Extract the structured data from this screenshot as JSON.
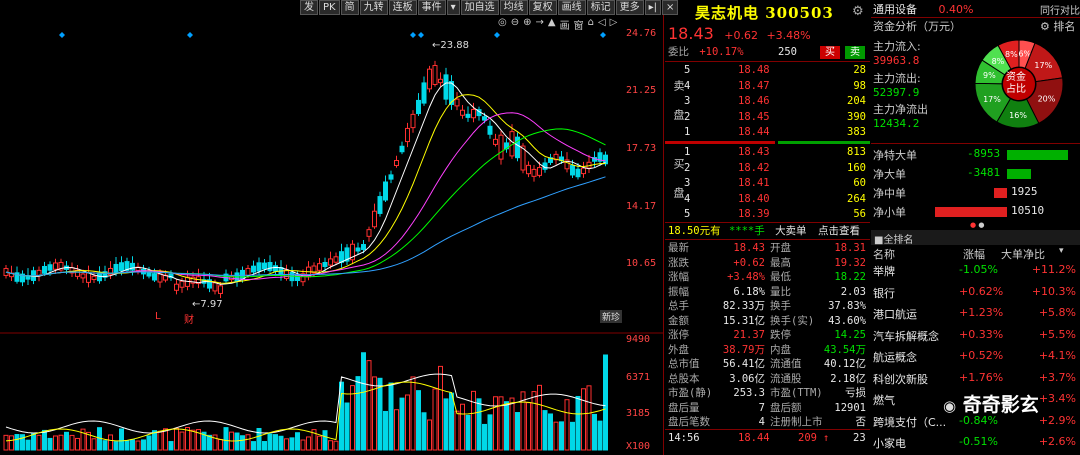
{
  "toolbar": [
    "发",
    "PK",
    "简",
    "九转",
    "连板",
    "事件",
    "▾",
    "加自选",
    "均线",
    "复权",
    "画线",
    "标记",
    "更多",
    "▸|",
    "×"
  ],
  "tool_icons": [
    "◎",
    "⊖",
    "⊕",
    "→",
    "▲",
    "画",
    "窗",
    "⌂",
    "◁",
    "▷"
  ],
  "price_axis": [
    "24.76",
    "21.25",
    "17.73",
    "14.17",
    "10.65"
  ],
  "volume_axis": [
    "9490",
    "6371",
    "3185",
    "X100"
  ],
  "annotations": {
    "high": "23.88",
    "low": "7.97",
    "L": "L",
    "cai": "财",
    "new": "新珍"
  },
  "quote": {
    "name": "昊志机电",
    "code": "300503",
    "price": "18.43",
    "change": "+0.62",
    "change_pct": "+3.48%",
    "weibi_label": "委比",
    "weibi_value": "+10.17%",
    "weibi_count": "250",
    "sell_btn": "买",
    "buy_btn": "卖",
    "sell_label": "卖盘",
    "buy_label": "买盘",
    "asks": [
      {
        "level": "5",
        "price": "18.48",
        "vol": "28"
      },
      {
        "level": "4",
        "price": "18.47",
        "vol": "98"
      },
      {
        "level": "3",
        "price": "18.46",
        "vol": "204"
      },
      {
        "level": "2",
        "price": "18.45",
        "vol": "390"
      },
      {
        "level": "1",
        "price": "18.44",
        "vol": "383"
      }
    ],
    "bids": [
      {
        "level": "1",
        "price": "18.43",
        "vol": "813"
      },
      {
        "level": "2",
        "price": "18.42",
        "vol": "160"
      },
      {
        "level": "3",
        "price": "18.41",
        "vol": "60"
      },
      {
        "level": "4",
        "price": "18.40",
        "vol": "264"
      },
      {
        "level": "5",
        "price": "18.39",
        "vol": "56"
      }
    ],
    "big_order": {
      "price": "18.50元有",
      "hand": "****手",
      "label": "大卖单",
      "link": "点击查看"
    },
    "stats": [
      [
        "最新",
        "18.43",
        "开盘",
        "18.31"
      ],
      [
        "涨跌",
        "+0.62",
        "最高",
        "19.32"
      ],
      [
        "涨幅",
        "+3.48%",
        "最低",
        "18.22"
      ],
      [
        "振幅",
        "6.18%",
        "量比",
        "2.03"
      ],
      [
        "总手",
        "82.33万",
        "换手",
        "37.83%"
      ],
      [
        "金额",
        "15.31亿",
        "换手(实)",
        "43.60%"
      ],
      [
        "涨停",
        "21.37",
        "跌停",
        "14.25"
      ],
      [
        "外盘",
        "38.79万",
        "内盘",
        "43.54万"
      ],
      [
        "总市值",
        "56.41亿",
        "流通值",
        "40.12亿"
      ],
      [
        "总股本",
        "3.06亿",
        "流通股",
        "2.18亿"
      ],
      [
        "市盈(静)",
        "253.3",
        "市盈(TTM)",
        "亏损"
      ],
      [
        "盘后量",
        "7",
        "盘后额",
        "12901"
      ],
      [
        "盘后笔数",
        "4",
        "注册制上市",
        "否"
      ]
    ],
    "tick": {
      "time": "14:56",
      "price": "18.44",
      "vol": "209",
      "arrow": "↑",
      "num": "23"
    }
  },
  "fund": {
    "sector": "通用设备",
    "sector_pct": "0.40%",
    "sector_link": "同行对比",
    "title": "资金分析（万元）",
    "inflow_label": "主力流入:",
    "inflow": "39963.8",
    "outflow_label": "主力流出:",
    "outflow": "52397.9",
    "net_label": "主力净流出",
    "net": "12434.2",
    "pie": {
      "center": "资金占比",
      "slices": [
        {
          "label": "8%",
          "value": 8,
          "color": "#e02020"
        },
        {
          "label": "6%",
          "value": 6,
          "color": "#ff5050"
        },
        {
          "label": "17%",
          "value": 17,
          "color": "#c01818"
        },
        {
          "label": "20%",
          "value": 20,
          "color": "#901010"
        },
        {
          "label": "16%",
          "value": 16,
          "color": "#108010"
        },
        {
          "label": "17%",
          "value": 17,
          "color": "#20a020"
        },
        {
          "label": "9%",
          "value": 9,
          "color": "#30c030"
        },
        {
          "label": "8%",
          "value": 8,
          "color": "#50e050"
        }
      ]
    },
    "bars": [
      {
        "label": "净特大单",
        "value": "-8953",
        "amount": 8953,
        "color": "#00b000"
      },
      {
        "label": "净大单",
        "value": "-3481",
        "amount": 3481,
        "color": "#00b000"
      },
      {
        "label": "净中单",
        "value": "1925",
        "amount": 1925,
        "color": "#e02020"
      },
      {
        "label": "净小单",
        "value": "10510",
        "amount": 10510,
        "color": "#e02020"
      }
    ],
    "rank_title": "全排名",
    "rank_headers": [
      "名称",
      "涨幅",
      "大单净比"
    ],
    "rank_rows": [
      [
        "举牌",
        "-1.05%",
        "+11.2%"
      ],
      [
        "银行",
        "+0.62%",
        "+10.3%"
      ],
      [
        "港口航运",
        "+1.23%",
        "+5.8%"
      ],
      [
        "汽车拆解概念",
        "+0.33%",
        "+5.5%"
      ],
      [
        "航运概念",
        "+0.52%",
        "+4.1%"
      ],
      [
        "科创次新股",
        "+1.76%",
        "+3.7%"
      ],
      [
        "燃气",
        "",
        "+3.4%"
      ],
      [
        "跨境支付（C...",
        "-0.84%",
        "+2.9%"
      ],
      [
        "小家电",
        "-0.51%",
        "+2.6%"
      ]
    ],
    "watermark": "奇奇影玄"
  }
}
